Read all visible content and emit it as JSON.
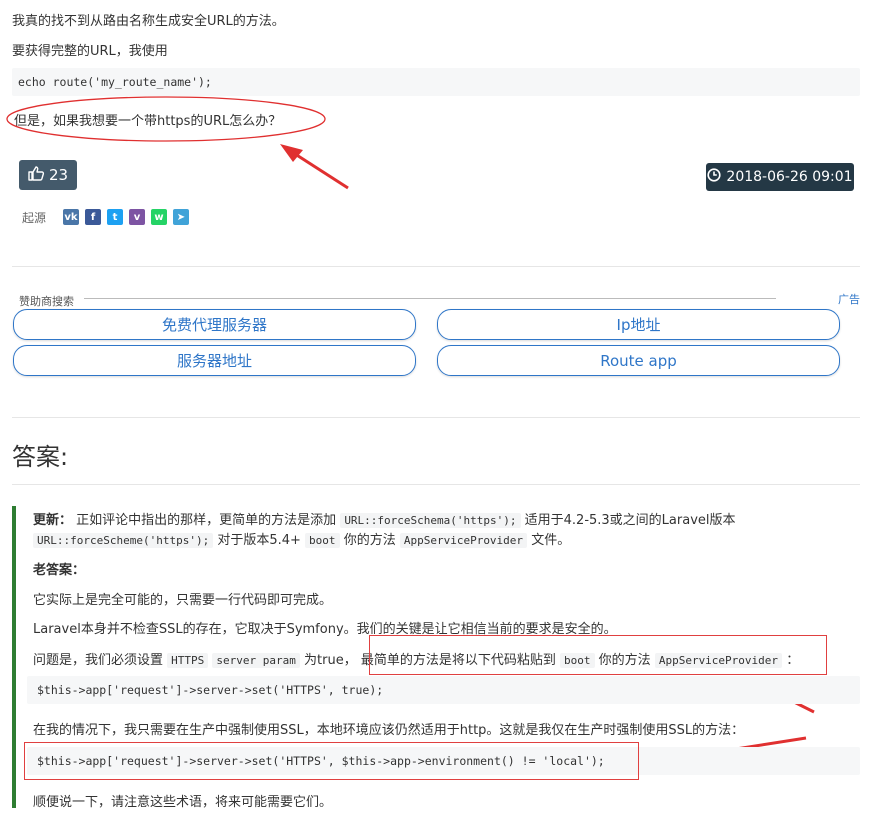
{
  "question": {
    "line1": "我真的找不到从路由名称生成安全URL的方法。",
    "line2": "要获得完整的URL，我使用",
    "code": "echo route('my_route_name');",
    "line3": "但是，如果我想要一个带https的URL怎么办？"
  },
  "votes": {
    "count": "23",
    "icon": "thumbs-up-icon"
  },
  "date": {
    "value": "2018-06-26 09:01",
    "icon": "clock-icon"
  },
  "source": {
    "label": "起源",
    "shares": [
      {
        "name": "vk",
        "glyph": "vk",
        "color": "#4a76a8"
      },
      {
        "name": "facebook",
        "glyph": "f",
        "color": "#3b5998"
      },
      {
        "name": "twitter",
        "glyph": "t",
        "color": "#1da1f2"
      },
      {
        "name": "viber",
        "glyph": "v",
        "color": "#7d54a3"
      },
      {
        "name": "whatsapp",
        "glyph": "w",
        "color": "#25d366"
      },
      {
        "name": "telegram",
        "glyph": "➤",
        "color": "#40a3d8"
      }
    ]
  },
  "sponsor": {
    "label": "赞助商搜索",
    "ad": "广告",
    "links": [
      "免费代理服务器",
      "Ip地址",
      "服务器地址",
      "Route app"
    ]
  },
  "answers": {
    "heading": "答案:",
    "update_label": "更新：",
    "update_text1": "正如评论中指出的那样，更简单的方法是添加",
    "update_code1": "URL::forceSchema('https');",
    "update_text2": "适用于4.2-5.3或之间的Laravel版本",
    "update_code2": "URL::forceScheme('https');",
    "update_text3": "对于版本5.4+",
    "update_code3": "boot",
    "update_text4": "你的方法",
    "update_code4": "AppServiceProvider",
    "update_text5": "文件。",
    "old_label": "老答案：",
    "p1": "它实际上是完全可能的，只需要一行代码即可完成。",
    "p2": "Laravel本身并不检查SSL的存在，它取决于Symfony。我们的关键是让它相信当前的要求是安全的。",
    "p3_text1": "问题是，我们必须设置",
    "p3_code1": "HTTPS",
    "p3_code2": "server param",
    "p3_text2": "为true，",
    "p3_text3": "最简单的方法是将以下代码粘贴到",
    "p3_code3": "boot",
    "p3_text4": "你的方法",
    "p3_code4": "AppServiceProvider",
    "p3_text5": "：",
    "code1": "$this->app['request']->server->set('HTTPS', true);",
    "p4": "在我的情况下，我只需要在生产中强制使用SSL，本地环境应该仍然适用于http。这就是我仅在生产时强制使用SSL的方法：",
    "code2": "$this->app['request']->server->set('HTTPS', $this->app->environment() != 'local');",
    "p5": "顺便说一下，请注意这些术语，将来可能需要它们。"
  },
  "colors": {
    "annotation": "#e03030",
    "link": "#2f76c8",
    "quote_bar": "#2e7d32"
  }
}
